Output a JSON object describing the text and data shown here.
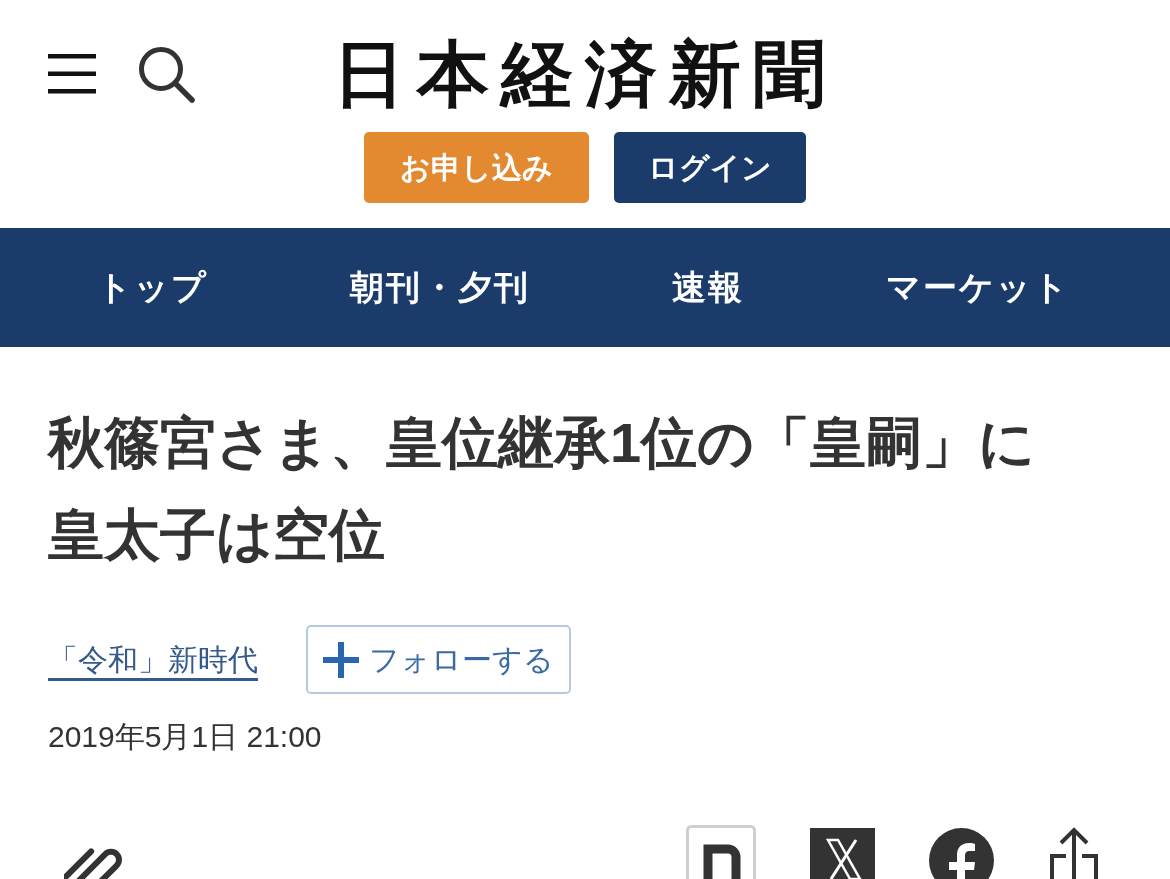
{
  "header": {
    "logo": "日本経済新聞",
    "buttons": [
      {
        "label": "お申し込み",
        "kind": "subscribe"
      },
      {
        "label": "ログイン",
        "kind": "login"
      }
    ]
  },
  "nav": {
    "items": [
      "トップ",
      "朝刊・夕刊",
      "速報",
      "マーケット"
    ]
  },
  "article": {
    "headline": "秋篠宮さま、皇位継承1位の「皇嗣」に皇太子は空位",
    "topic_link": "「令和」新時代",
    "follow_button": "フォローする",
    "date": "2019年5月1日 21:00"
  }
}
